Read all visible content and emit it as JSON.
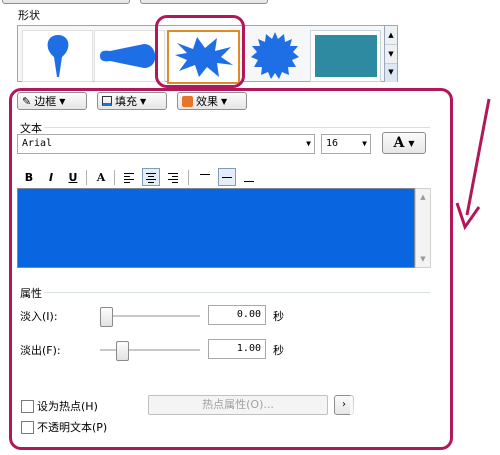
{
  "shapes": {
    "section_label": "形状",
    "items": [
      {
        "name": "balloon-pin-shape"
      },
      {
        "name": "teardrop-shape"
      },
      {
        "name": "explosion-shape",
        "selected": true
      },
      {
        "name": "starburst-shape"
      },
      {
        "name": "rectangle-shape"
      }
    ],
    "fill_color": "#1e6fe6",
    "rect_color": "#2d8aa0"
  },
  "toolbar": {
    "border_label": "边框",
    "fill_label": "填充",
    "effect_label": "效果"
  },
  "text_section": {
    "label": "文本",
    "font_name": "Arial",
    "font_size": "16",
    "color_button": "A",
    "format": {
      "bold": "B",
      "italic": "I",
      "underline": "U",
      "color": "A"
    },
    "textarea_color": "#0a66e0"
  },
  "properties": {
    "label": "属性",
    "fade_in_label": "淡入(I):",
    "fade_in_value": "0.00",
    "fade_in_level": 0.0,
    "fade_out_label": "淡出(F):",
    "fade_out_value": "1.00",
    "fade_out_level": 0.2,
    "seconds_unit": "秒"
  },
  "hotspot": {
    "set_as_hotspot_label": "设为热点(H)",
    "hotspot_props_button": "热点属性(O)...",
    "opaque_text_label": "不透明文本(P)"
  },
  "annotation_color": "#b0185a"
}
